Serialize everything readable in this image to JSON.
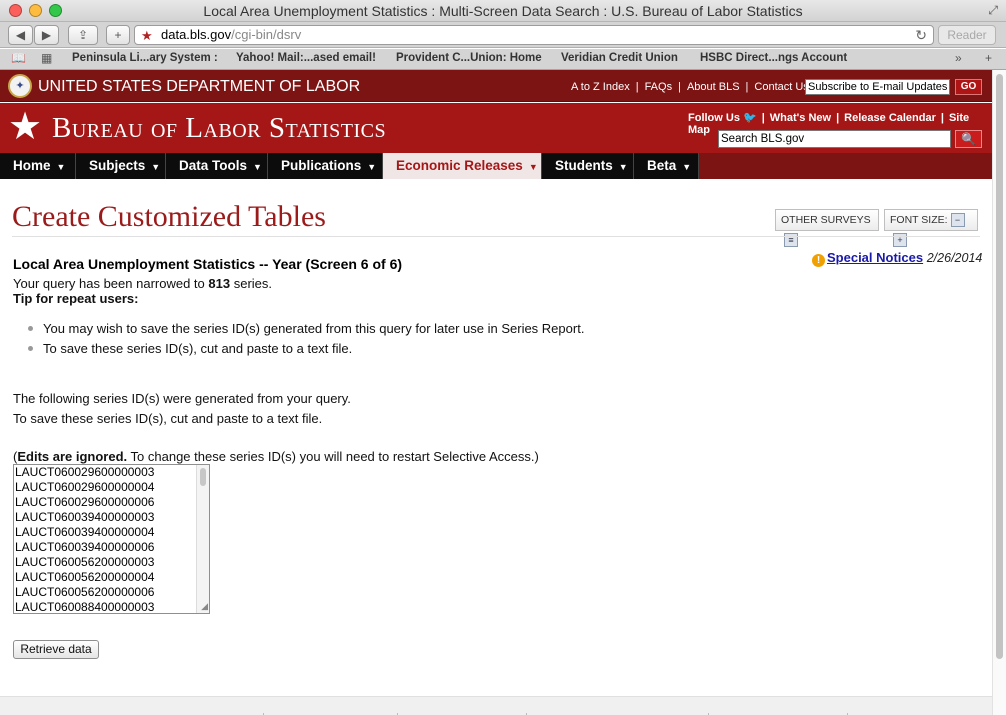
{
  "window": {
    "title": "Local Area Unemployment Statistics : Multi-Screen Data Search : U.S. Bureau of Labor Statistics"
  },
  "toolbar": {
    "url_domain": "data.bls.gov",
    "url_path": "/cgi-bin/dsrv",
    "reader_label": "Reader",
    "back_glyph": "◀",
    "forward_glyph": "▶",
    "share_glyph": "⇪",
    "add_glyph": "+",
    "reload_glyph": "↻"
  },
  "bookmarks": [
    "Peninsula Li...ary System :",
    "Yahoo! Mail:...ased email!",
    "Provident C...Union: Home",
    "Veridian Credit Union",
    "HSBC Direct...ngs Account"
  ],
  "dol": {
    "title": "UNITED STATES DEPARTMENT OF LABOR",
    "links": [
      "A to Z Index",
      "FAQs",
      "About BLS",
      "Contact Us"
    ],
    "subscribe_value": "Subscribe to E-mail Updates",
    "go_label": "GO"
  },
  "bls": {
    "title": "Bureau of Labor Statistics",
    "top_links": [
      "Follow Us",
      "What's New",
      "Release Calendar",
      "Site Map"
    ],
    "search_value": "Search BLS.gov"
  },
  "nav": [
    {
      "label": "Home"
    },
    {
      "label": "Subjects"
    },
    {
      "label": "Data Tools"
    },
    {
      "label": "Publications"
    },
    {
      "label": "Economic Releases"
    },
    {
      "label": "Students"
    },
    {
      "label": "Beta"
    }
  ],
  "page": {
    "title": "Create Customized Tables",
    "other_surveys": "OTHER SURVEYS",
    "font_size": "FONT SIZE:",
    "subheading": "Local Area Unemployment Statistics -- Year (Screen 6 of 6)",
    "special_notices": "Special Notices",
    "notice_date": "2/26/2014",
    "query_prefix": "Your query has been narrowed to",
    "query_count": "813",
    "query_suffix": "series.",
    "tip_heading": "Tip for repeat users:",
    "tips": [
      "You may wish to save the series ID(s) generated from this query for later use in Series Report.",
      "To save these series ID(s), cut and paste to a text file."
    ],
    "generated_1": "The following series ID(s) were generated from your query.",
    "generated_2": "To save these series ID(s), cut and paste to a text file.",
    "edits_bold": "Edits are ignored.",
    "edits_rest": "To change these series ID(s) you will need to restart Selective Access.)",
    "edits_open": "(",
    "series_ids": [
      "LAUCT060029600000003",
      "LAUCT060029600000004",
      "LAUCT060029600000006",
      "LAUCT060039400000003",
      "LAUCT060039400000004",
      "LAUCT060039400000006",
      "LAUCT060056200000003",
      "LAUCT060056200000004",
      "LAUCT060056200000006",
      "LAUCT060088400000003"
    ],
    "retrieve_label": "Retrieve data"
  },
  "colors": {
    "dol_red": "#7d1414",
    "bls_red": "#a51717",
    "title_red": "#9b1b1b",
    "nav_black": "#0c0c0c",
    "link_blue": "#1a1aa8"
  }
}
